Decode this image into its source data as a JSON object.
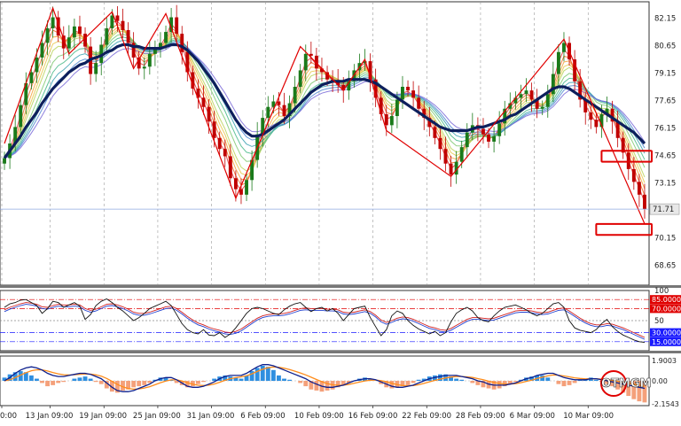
{
  "chart_data": [
    {
      "type": "line",
      "name": "price",
      "y_ticks": [
        "82.15",
        "80.65",
        "79.15",
        "77.65",
        "76.15",
        "74.65",
        "73.15",
        "71.71",
        "70.15",
        "68.65"
      ],
      "y_tick_values": [
        82.15,
        80.65,
        79.15,
        77.65,
        76.15,
        74.65,
        73.15,
        71.71,
        70.15,
        68.65
      ],
      "ylim": [
        67.55,
        83.05
      ],
      "current_price": "71.71",
      "current_price_value": 71.71,
      "x_count": 120,
      "close": [
        74.5,
        75.3,
        76.2,
        77.4,
        78.6,
        79.2,
        80.0,
        80.8,
        81.6,
        82.2,
        81.2,
        80.5,
        81.1,
        81.7,
        81.3,
        80.6,
        79.1,
        79.7,
        80.7,
        81.6,
        82.3,
        82.0,
        81.5,
        80.8,
        80.0,
        79.4,
        79.5,
        80.2,
        80.5,
        80.8,
        81.4,
        82.2,
        81.3,
        80.3,
        79.2,
        78.3,
        77.8,
        77.3,
        76.5,
        75.6,
        75.0,
        74.6,
        73.4,
        72.8,
        72.5,
        73.3,
        74.4,
        75.8,
        76.7,
        77.3,
        77.6,
        77.4,
        76.8,
        77.5,
        78.4,
        79.3,
        80.2,
        80.1,
        79.4,
        79.2,
        78.8,
        78.7,
        78.5,
        78.2,
        78.7,
        79.3,
        79.7,
        79.8,
        78.8,
        77.8,
        76.9,
        76.3,
        76.8,
        77.7,
        78.4,
        78.2,
        77.8,
        77.2,
        76.7,
        76.2,
        75.6,
        75.0,
        74.2,
        73.6,
        74.3,
        75.1,
        75.9,
        76.3,
        76.1,
        75.8,
        75.4,
        75.7,
        76.4,
        77.2,
        77.5,
        77.8,
        78.0,
        78.2,
        77.7,
        77.2,
        77.3,
        78.0,
        79.1,
        80.3,
        80.8,
        79.9,
        78.7,
        77.7,
        77.0,
        76.6,
        76.2,
        76.9,
        77.2,
        76.5,
        75.6,
        74.8,
        73.9,
        73.2,
        72.5,
        71.7
      ],
      "main_ma": [
        74.5,
        74.9,
        75.3,
        75.7,
        76.2,
        76.6,
        77.0,
        77.5,
        77.9,
        78.3,
        78.6,
        78.9,
        79.2,
        79.4,
        79.6,
        79.7,
        79.9,
        80.0,
        80.1,
        80.3,
        80.4,
        80.6,
        80.7,
        80.7,
        80.6,
        80.6,
        80.5,
        80.5,
        80.5,
        80.5,
        80.6,
        80.7,
        80.7,
        80.6,
        80.4,
        80.1,
        79.8,
        79.4,
        79.0,
        78.6,
        78.1,
        77.6,
        77.1,
        76.6,
        76.2,
        75.9,
        75.7,
        75.7,
        75.8,
        76.0,
        76.2,
        76.4,
        76.6,
        76.9,
        77.2,
        77.5,
        77.8,
        78.1,
        78.3,
        78.5,
        78.6,
        78.7,
        78.7,
        78.7,
        78.8,
        78.8,
        78.8,
        78.8,
        78.7,
        78.6,
        78.4,
        78.2,
        78.0,
        77.8,
        77.6,
        77.4,
        77.2,
        77.0,
        76.8,
        76.6,
        76.4,
        76.2,
        76.1,
        76.0,
        76.0,
        76.0,
        76.0,
        76.1,
        76.2,
        76.2,
        76.3,
        76.4,
        76.5,
        76.6,
        76.8,
        76.9,
        77.1,
        77.3,
        77.5,
        77.7,
        77.9,
        78.1,
        78.3,
        78.4,
        78.4,
        78.3,
        78.1,
        77.9,
        77.7,
        77.5,
        77.3,
        77.1,
        76.9,
        76.7,
        76.5,
        76.3,
        76.1,
        75.9,
        75.6,
        75.3
      ],
      "zigzag": [
        [
          0,
          75.3
        ],
        [
          9,
          82.7
        ],
        [
          12,
          80.2
        ],
        [
          20,
          82.5
        ],
        [
          24,
          79.4
        ],
        [
          30,
          82.4
        ],
        [
          43,
          72.3
        ],
        [
          55,
          80.6
        ],
        [
          63,
          78.2
        ],
        [
          67,
          79.9
        ],
        [
          71,
          76.0
        ],
        [
          83,
          73.5
        ],
        [
          104,
          81.0
        ],
        [
          119,
          70.9
        ]
      ],
      "boxes": [
        {
          "x_start": 111,
          "x_end": 119,
          "y_top": 74.9,
          "y_bottom": 74.3,
          "color": "#e00000"
        },
        {
          "x_start": 110,
          "x_end": 119,
          "y_top": 70.9,
          "y_bottom": 70.3,
          "color": "#e00000"
        }
      ]
    },
    {
      "type": "line",
      "name": "rsi",
      "y_ticks": [
        "100",
        "85.0000",
        "70.0000",
        "50",
        "30.0000",
        "15.0000"
      ],
      "y_tick_values": [
        100,
        85,
        70,
        50,
        30,
        15
      ],
      "ylim": [
        0,
        100
      ],
      "levels": [
        85,
        70,
        50,
        30,
        15
      ],
      "highlighted_levels": {
        "85": "#e00000",
        "70": "#e00000",
        "30": "#1a1aff",
        "15": "#1a1aff"
      },
      "values": [
        72,
        78,
        80,
        84,
        85,
        80,
        75,
        62,
        70,
        82,
        80,
        72,
        76,
        80,
        74,
        52,
        60,
        75,
        82,
        86,
        80,
        72,
        66,
        58,
        50,
        55,
        62,
        70,
        74,
        78,
        82,
        75,
        60,
        45,
        35,
        30,
        28,
        35,
        26,
        25,
        30,
        22,
        28,
        38,
        50,
        62,
        70,
        72,
        70,
        66,
        62,
        60,
        68,
        74,
        78,
        80,
        72,
        65,
        70,
        72,
        66,
        70,
        62,
        50,
        60,
        70,
        72,
        74,
        55,
        40,
        25,
        35,
        58,
        66,
        62,
        50,
        42,
        36,
        32,
        28,
        32,
        25,
        30,
        48,
        62,
        68,
        72,
        66,
        55,
        50,
        48,
        58,
        66,
        72,
        74,
        76,
        72,
        68,
        62,
        58,
        62,
        70,
        78,
        80,
        72,
        50,
        38,
        34,
        32,
        30,
        35,
        45,
        52,
        40,
        32,
        26,
        22,
        18,
        15,
        14
      ],
      "signal": [
        68,
        72,
        75,
        78,
        80,
        79,
        77,
        73,
        72,
        75,
        77,
        76,
        76,
        77,
        76,
        70,
        67,
        69,
        73,
        77,
        78,
        76,
        73,
        69,
        64,
        62,
        62,
        64,
        67,
        70,
        73,
        74,
        70,
        64,
        57,
        51,
        46,
        43,
        39,
        36,
        34,
        31,
        30,
        32,
        36,
        42,
        48,
        54,
        58,
        60,
        61,
        61,
        62,
        64,
        67,
        70,
        71,
        70,
        70,
        70,
        69,
        69,
        68,
        64,
        63,
        64,
        66,
        68,
        65,
        59,
        51,
        47,
        50,
        54,
        56,
        55,
        52,
        48,
        44,
        40,
        38,
        35,
        34,
        37,
        42,
        47,
        52,
        55,
        55,
        54,
        53,
        54,
        57,
        60,
        63,
        66,
        67,
        67,
        66,
        64,
        63,
        64,
        67,
        70,
        71,
        66,
        60,
        54,
        49,
        45,
        43,
        43,
        45,
        44,
        41,
        38,
        34,
        30,
        26,
        22
      ]
    },
    {
      "type": "bar",
      "name": "macd",
      "y_ticks": [
        "1.9003",
        "0.00",
        "-2.1543"
      ],
      "y_tick_values": [
        1.9003,
        0.0,
        -2.1543
      ],
      "ylim": [
        -2.3,
        2.3
      ],
      "histogram": [
        0.3,
        0.6,
        0.8,
        0.9,
        0.8,
        0.5,
        0.2,
        -0.2,
        -0.5,
        -0.4,
        -0.2,
        -0.1,
        0.0,
        0.2,
        0.3,
        0.4,
        0.2,
        -0.1,
        -0.3,
        -0.7,
        -1.0,
        -1.1,
        -0.9,
        -0.8,
        -0.6,
        -0.5,
        -0.4,
        -0.2,
        0.1,
        0.3,
        0.3,
        0.1,
        -0.2,
        -0.4,
        -0.6,
        -0.5,
        -0.3,
        -0.1,
        0.0,
        0.2,
        0.4,
        0.5,
        0.4,
        0.3,
        0.2,
        0.5,
        0.9,
        1.2,
        1.4,
        1.3,
        1.0,
        0.5,
        0.2,
        0.1,
        0.0,
        -0.2,
        -0.5,
        -0.8,
        -0.9,
        -1.0,
        -0.9,
        -0.8,
        -0.6,
        -0.4,
        -0.2,
        0.0,
        0.2,
        0.3,
        0.2,
        0.0,
        -0.3,
        -0.6,
        -0.7,
        -0.6,
        -0.5,
        -0.4,
        -0.2,
        0.1,
        0.2,
        0.4,
        0.5,
        0.6,
        0.6,
        0.4,
        0.2,
        0.1,
        0.0,
        -0.2,
        -0.4,
        -0.6,
        -0.7,
        -0.8,
        -0.7,
        -0.5,
        -0.3,
        -0.1,
        0.1,
        0.3,
        0.4,
        0.5,
        0.5,
        0.3,
        0.0,
        -0.3,
        -0.5,
        -0.4,
        -0.2,
        0.1,
        0.2,
        0.3,
        0.1,
        -0.1,
        -0.3,
        -0.5,
        -0.8,
        -1.1,
        -1.4,
        -1.7,
        -1.9,
        -2.0
      ],
      "macd_line": [
        0.0,
        0.3,
        0.7,
        1.0,
        1.2,
        1.3,
        1.2,
        1.0,
        0.7,
        0.5,
        0.4,
        0.4,
        0.5,
        0.6,
        0.7,
        0.7,
        0.6,
        0.4,
        0.2,
        -0.2,
        -0.6,
        -0.9,
        -1.0,
        -1.0,
        -0.9,
        -0.7,
        -0.5,
        -0.3,
        0.0,
        0.2,
        0.3,
        0.3,
        0.1,
        -0.2,
        -0.5,
        -0.6,
        -0.6,
        -0.5,
        -0.3,
        -0.1,
        0.2,
        0.4,
        0.5,
        0.5,
        0.5,
        0.7,
        1.0,
        1.3,
        1.5,
        1.5,
        1.4,
        1.2,
        1.0,
        0.8,
        0.6,
        0.4,
        0.2,
        -0.1,
        -0.3,
        -0.5,
        -0.6,
        -0.6,
        -0.5,
        -0.4,
        -0.2,
        0.0,
        0.1,
        0.2,
        0.2,
        0.1,
        -0.1,
        -0.3,
        -0.5,
        -0.6,
        -0.6,
        -0.5,
        -0.4,
        -0.2,
        0.0,
        0.2,
        0.3,
        0.4,
        0.5,
        0.5,
        0.5,
        0.4,
        0.3,
        0.2,
        0.0,
        -0.1,
        -0.3,
        -0.4,
        -0.4,
        -0.4,
        -0.3,
        -0.2,
        0.0,
        0.2,
        0.3,
        0.5,
        0.6,
        0.7,
        0.7,
        0.5,
        0.3,
        0.2,
        0.1,
        0.1,
        0.1,
        0.2,
        0.2,
        0.1,
        0.0,
        -0.1,
        -0.2,
        -0.3,
        -0.4,
        -0.5,
        -0.6,
        -0.7
      ]
    }
  ],
  "x_ticks": [
    {
      "label": "0:00",
      "index": 0
    },
    {
      "label": "13 Jan 09:00",
      "index": 9
    },
    {
      "label": "19 Jan 09:00",
      "index": 19
    },
    {
      "label": "25 Jan 09:00",
      "index": 29
    },
    {
      "label": "31 Jan 09:00",
      "index": 39
    },
    {
      "label": "6 Feb 09:00",
      "index": 49
    },
    {
      "label": "10 Feb 09:00",
      "index": 59
    },
    {
      "label": "16 Feb 09:00",
      "index": 69
    },
    {
      "label": "22 Feb 09:00",
      "index": 79
    },
    {
      "label": "28 Feb 09:00",
      "index": 89
    },
    {
      "label": "6 Mar 09:00",
      "index": 99
    },
    {
      "label": "10 Mar 09:00",
      "index": 109
    }
  ],
  "watermark": "OTMGM",
  "colors": {
    "candle_up": "#1a7a1a",
    "candle_down": "#c00000",
    "zigzag": "#e00000",
    "main_ma": "#0d1f5c",
    "price_line": "#8fa8e0",
    "rsi_line": "#111111",
    "rsi_signal_a": "#d02020",
    "rsi_signal_b": "#2040d0",
    "macd_hist_pos": "#2f8fe0",
    "macd_hist_neg": "#f4a07a",
    "macd_line": "#0d1f8c",
    "macd_signal": "#ff8c1a"
  }
}
